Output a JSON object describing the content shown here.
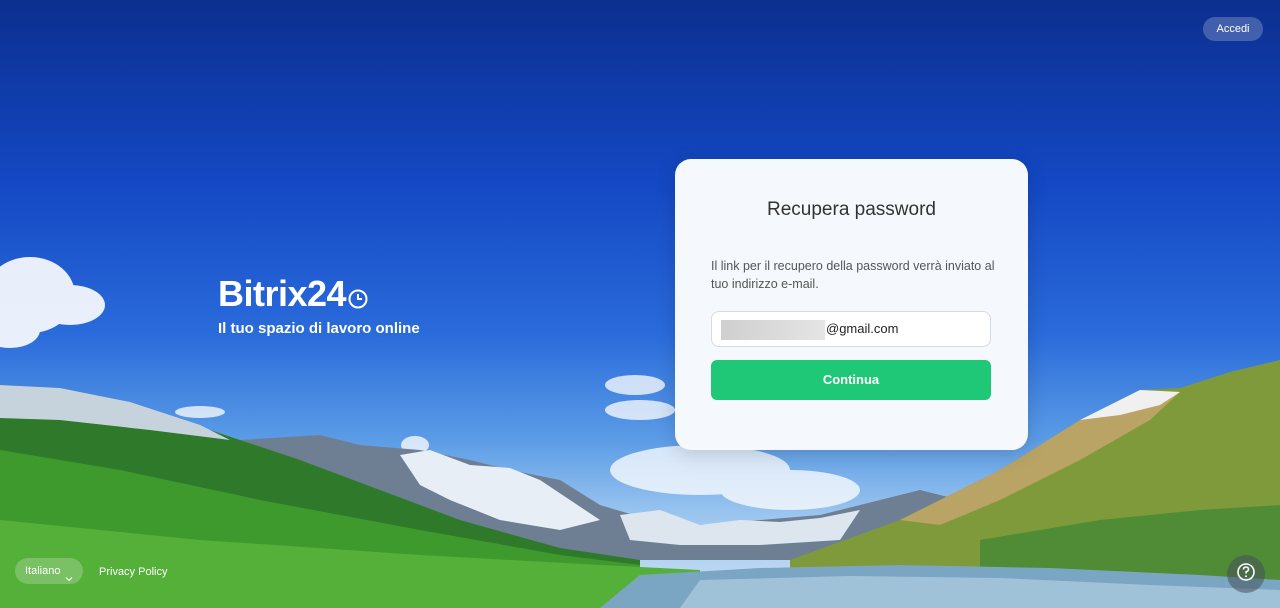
{
  "header": {
    "signin_label": "Accedi"
  },
  "brand": {
    "logo_text": "Bitrix24",
    "tagline": "Il tuo spazio di lavoro online"
  },
  "recovery_card": {
    "title": "Recupera password",
    "description": "Il link per il recupero della password verrà inviato al tuo indirizzo e-mail.",
    "email_visible_suffix": "@gmail.com",
    "continue_label": "Continua"
  },
  "footer": {
    "language_label": "Italiano",
    "privacy_label": "Privacy Policy"
  },
  "colors": {
    "continue_button": "#1fc876",
    "card_background": "#f5f8fc"
  },
  "icons": {
    "brand_clock": "clock-icon",
    "language_dropdown": "chevron-down-icon",
    "help": "help-icon"
  }
}
